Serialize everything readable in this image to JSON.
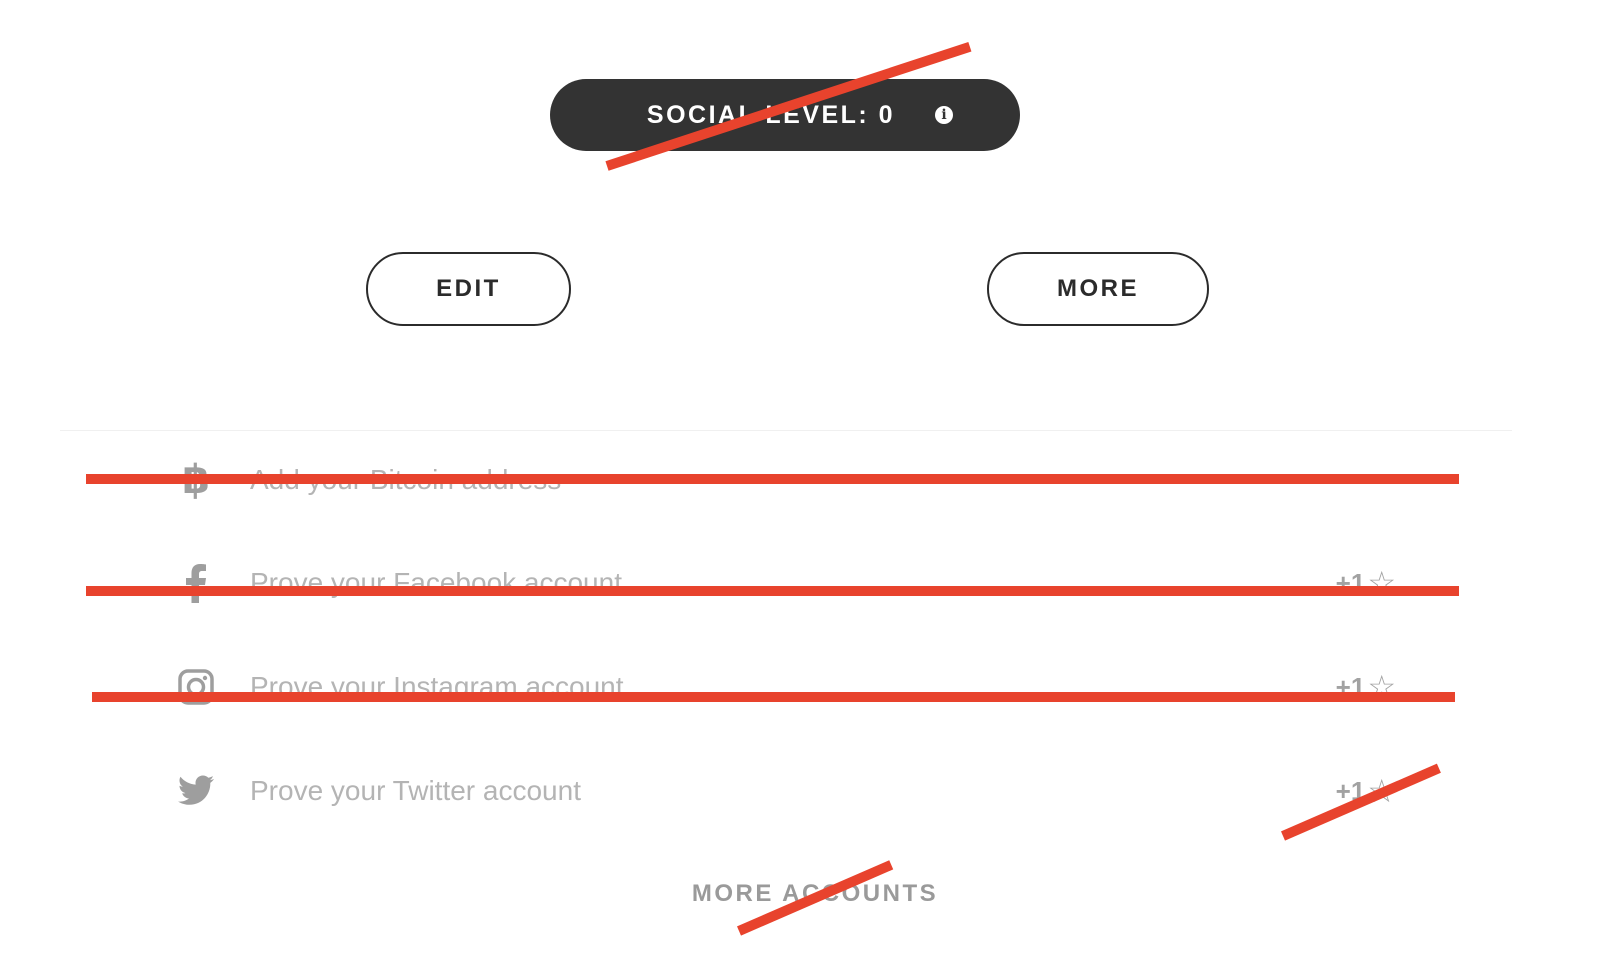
{
  "social_level": {
    "label": "SOCIAL LEVEL: 0"
  },
  "buttons": {
    "edit": "EDIT",
    "more": "MORE"
  },
  "accounts": [
    {
      "label": "Add your Bitcoin address",
      "icon": "bitcoin-icon",
      "points": ""
    },
    {
      "label": "Prove your Facebook account",
      "icon": "facebook-icon",
      "points": "+1"
    },
    {
      "label": "Prove your Instagram account",
      "icon": "instagram-icon",
      "points": "+1"
    },
    {
      "label": "Prove your Twitter account",
      "icon": "twitter-icon",
      "points": "+1"
    }
  ],
  "more_accounts": "MORE ACCOUNTS",
  "colors": {
    "pill_background": "#333333",
    "strike_red": "#e8432d",
    "label_gray": "#b4b4b4"
  }
}
